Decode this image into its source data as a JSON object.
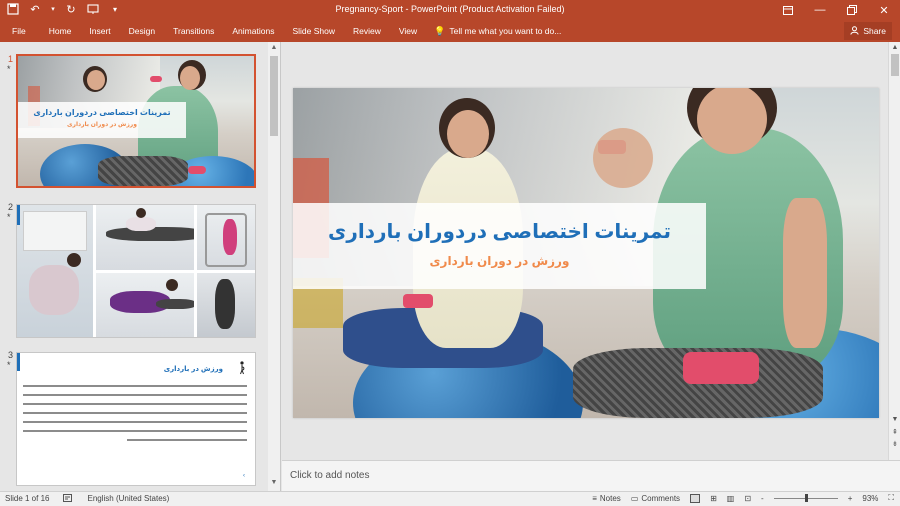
{
  "window": {
    "title": "Pregnancy-Sport - PowerPoint (Product Activation Failed)",
    "controls": [
      "ribbon-display",
      "minimize",
      "restore",
      "close"
    ]
  },
  "qat": {
    "icons": [
      "save-icon",
      "undo-icon",
      "redo-icon",
      "start-from-beginning-icon",
      "customize-icon"
    ]
  },
  "ribbon": {
    "tabs": [
      "File",
      "Home",
      "Insert",
      "Design",
      "Transitions",
      "Animations",
      "Slide Show",
      "Review",
      "View"
    ],
    "tell_me": "Tell me what you want to do...",
    "share": "Share"
  },
  "thumbnails": [
    {
      "number": "1",
      "star": "*"
    },
    {
      "number": "2",
      "star": "*"
    },
    {
      "number": "3",
      "star": "*"
    }
  ],
  "slide1": {
    "title": "تمرینات اختصاصی دردوران بارداری",
    "subtitle": "ورزش در دوران بارداری"
  },
  "slide3": {
    "heading": "ورزش در بارداری"
  },
  "notes": {
    "placeholder": "Click to add notes"
  },
  "status": {
    "slide_info": "Slide 1 of 16",
    "language": "English (United States)",
    "notes_btn": "Notes",
    "comments_btn": "Comments",
    "zoom": "93%",
    "zoom_min": "-",
    "zoom_plus": "+"
  },
  "colors": {
    "accent": "#b7472a",
    "title_blue": "#1f6fb8",
    "subtitle_orange": "#f08a4b",
    "selected_border": "#d35230"
  }
}
